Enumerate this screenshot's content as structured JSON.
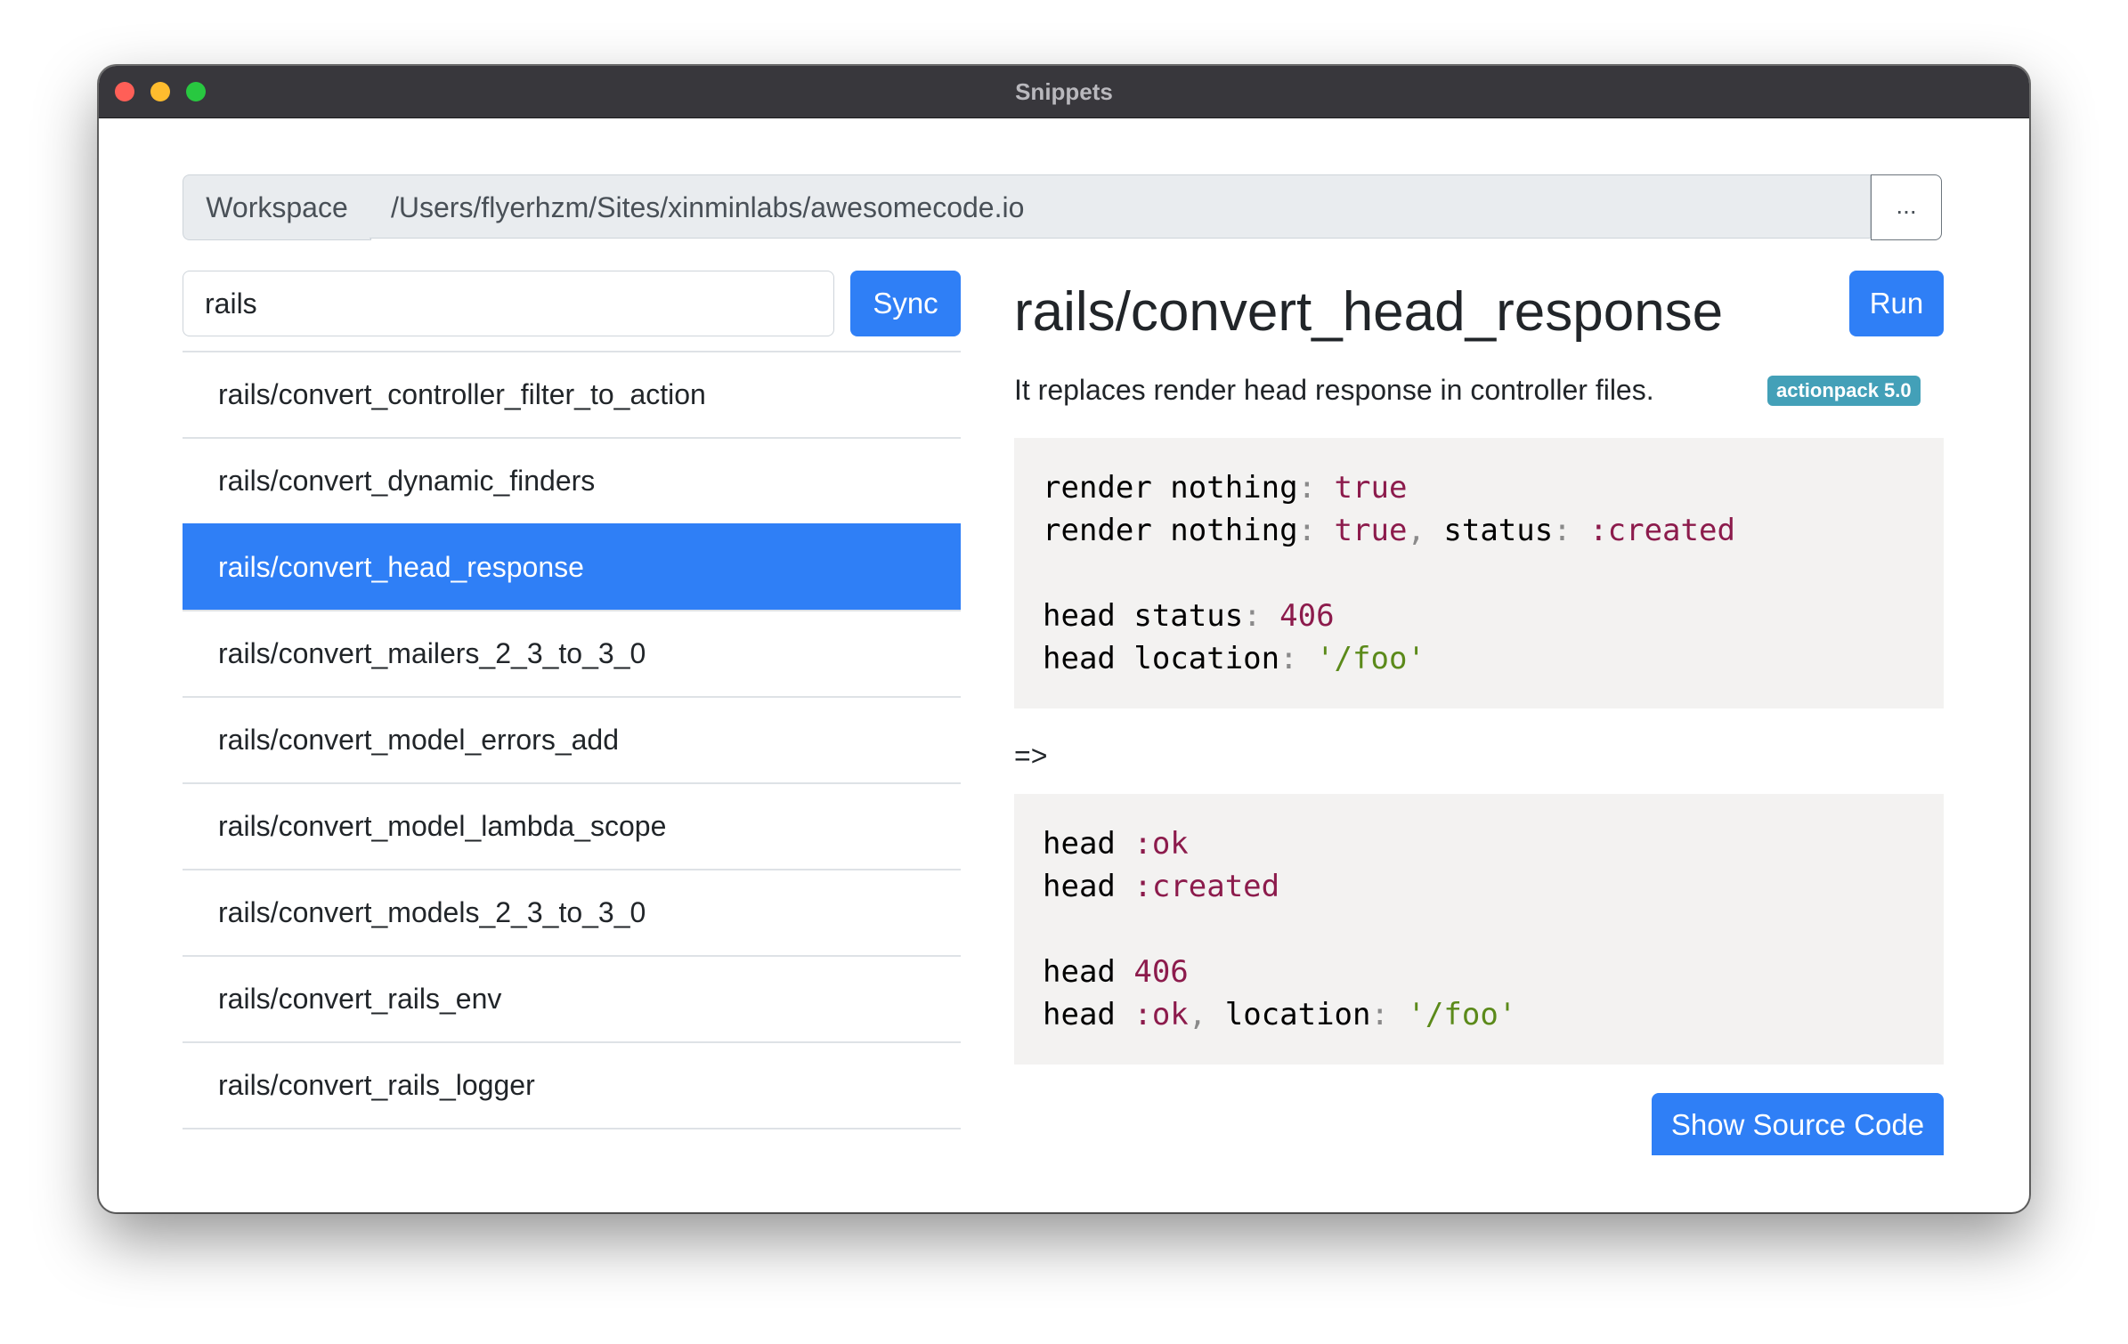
{
  "window": {
    "title": "Snippets"
  },
  "workspace": {
    "label": "Workspace",
    "path": "/Users/flyerhzm/Sites/xinminlabs/awesomecode.io",
    "browse_label": "..."
  },
  "search": {
    "value": "rails",
    "placeholder": ""
  },
  "sync_label": "Sync",
  "snippets": [
    {
      "label": "rails/convert_controller_filter_to_action",
      "active": false
    },
    {
      "label": "rails/convert_dynamic_finders",
      "active": false
    },
    {
      "label": "rails/convert_head_response",
      "active": true
    },
    {
      "label": "rails/convert_mailers_2_3_to_3_0",
      "active": false
    },
    {
      "label": "rails/convert_model_errors_add",
      "active": false
    },
    {
      "label": "rails/convert_model_lambda_scope",
      "active": false
    },
    {
      "label": "rails/convert_models_2_3_to_3_0",
      "active": false
    },
    {
      "label": "rails/convert_rails_env",
      "active": false
    },
    {
      "label": "rails/convert_rails_logger",
      "active": false
    }
  ],
  "detail": {
    "title": "rails/convert_head_response",
    "run_label": "Run",
    "description": "It replaces render head response in controller files.",
    "badge": "actionpack 5.0",
    "arrow": "=>",
    "show_source_label": "Show Source Code",
    "code_before": {
      "line1": {
        "a": "render nothing",
        "b": ":",
        "c": " true"
      },
      "line2": {
        "a": "render nothing",
        "b": ":",
        "c": " true",
        "d": ",",
        "e": " status",
        "f": ":",
        "g": " :created"
      },
      "line4": {
        "a": "head status",
        "b": ":",
        "c": " 406"
      },
      "line5": {
        "a": "head location",
        "b": ":",
        "c": " '/foo'"
      }
    },
    "code_after": {
      "line1": {
        "a": "head ",
        "b": ":ok"
      },
      "line2": {
        "a": "head ",
        "b": ":created"
      },
      "line4": {
        "a": "head ",
        "b": "406"
      },
      "line5": {
        "a": "head ",
        "b": ":ok",
        "c": ",",
        "d": " location",
        "e": ":",
        "f": " '/foo'"
      }
    }
  },
  "colors": {
    "accent": "#2f7ff6",
    "badge": "#43a0b8",
    "code_literal": "#8c1b4c",
    "code_string": "#5b8a1a",
    "code_background": "#f3f2f1"
  }
}
